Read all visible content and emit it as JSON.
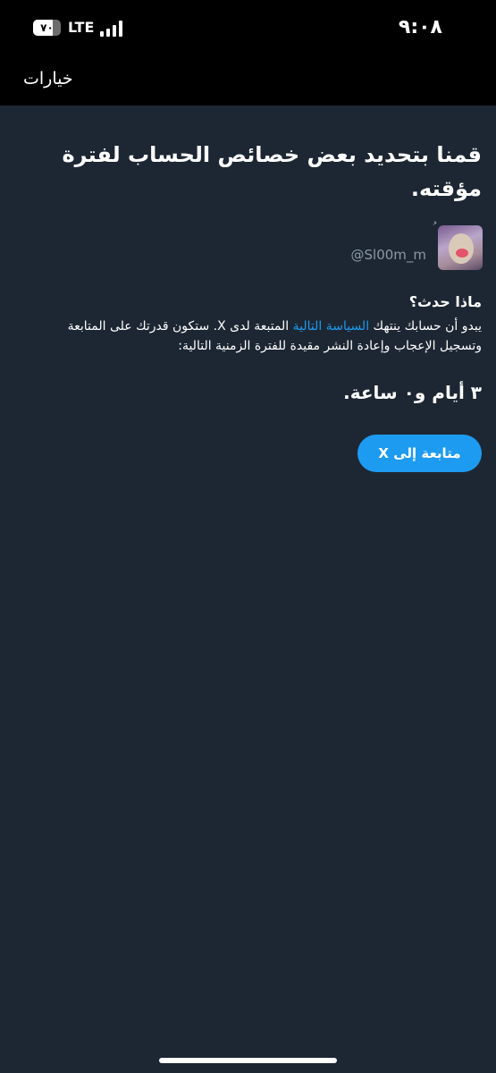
{
  "status_bar": {
    "battery_level_text": "٧٠",
    "battery_level_fraction": 0.7,
    "network_label": "LTE",
    "time": "٩:٠٨"
  },
  "nav": {
    "options_label": "خيارات"
  },
  "main": {
    "title": "قمنا بتحديد بعض خصائص الحساب لفترة مؤقته.",
    "user": {
      "name": "ُ",
      "handle": "@Sl00m_m"
    },
    "section_heading": "ماذا حدث؟",
    "body_before_link": "يبدو أن حسابك ينتهك ",
    "policy_link_label": "السياسة التالية",
    "body_after_link": " المتبعة لدى X. ستكون قدرتك على المتابعة وتسجيل الإعجاب وإعادة النشر مقيدة للفترة الزمنية التالية:",
    "duration": "٣ أيام و٠ ساعة.",
    "continue_button_label": "متابعة إلى X"
  },
  "colors": {
    "background": "#1d2733",
    "bar_background": "#000000",
    "accent": "#1d9bf0",
    "secondary_text": "#8b98a5"
  }
}
